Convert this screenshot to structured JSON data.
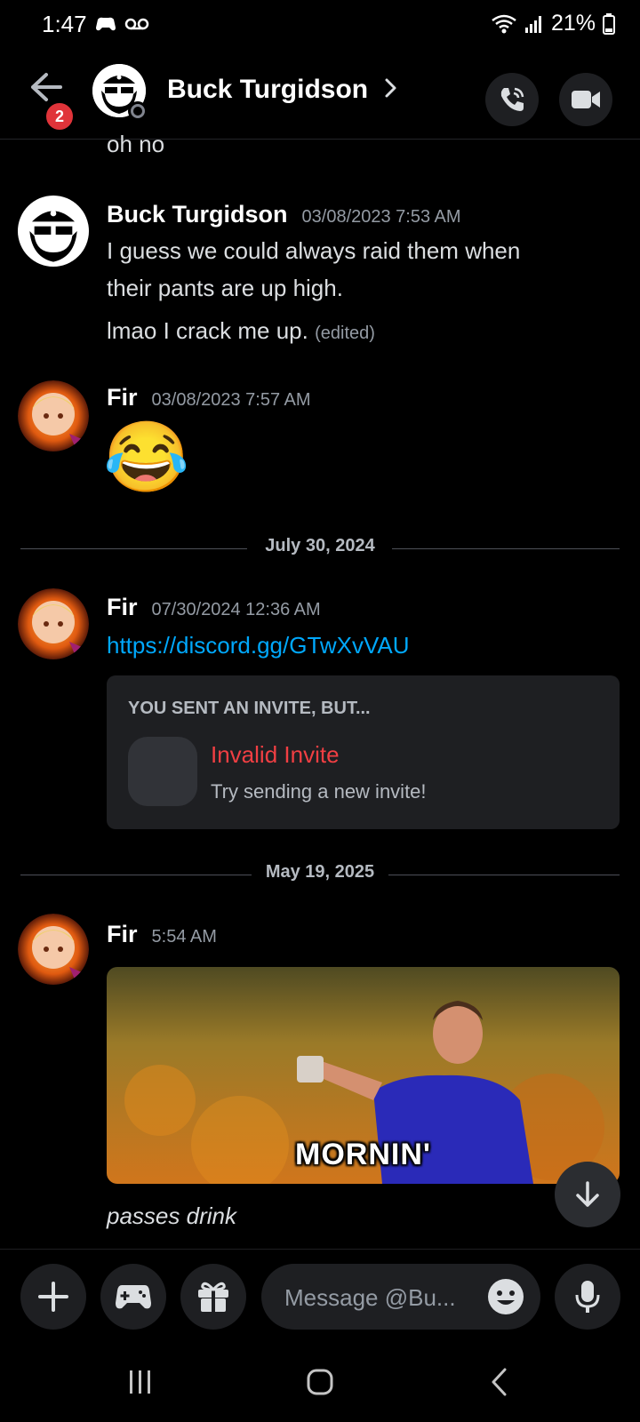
{
  "status_bar": {
    "time": "1:47",
    "battery": "21%"
  },
  "header": {
    "back_badge": "2",
    "contact_name": "Buck Turgidson"
  },
  "messages": {
    "top_fragment": "oh no",
    "m1": {
      "author": "Buck Turgidson",
      "timestamp": "03/08/2023 7:53 AM",
      "line1": "I guess we could always raid them when",
      "line2": "their pants are up high.",
      "line3": "lmao I crack me up.",
      "edited": "(edited)"
    },
    "m2": {
      "author": "Fir",
      "timestamp": "03/08/2023 7:57 AM",
      "emoji": "😂"
    },
    "divider1": "July 30, 2024",
    "m3": {
      "author": "Fir",
      "timestamp": "07/30/2024 12:36 AM",
      "link": "https://discord.gg/GTwXvVAU",
      "invite": {
        "heading": "YOU SENT AN INVITE, BUT...",
        "title": "Invalid Invite",
        "subtitle": "Try sending a new invite!"
      }
    },
    "divider2": "May 19, 2025",
    "m4": {
      "author": "Fir",
      "timestamp": "5:54 AM",
      "gif_caption": "MORNIN'",
      "text": "passes drink"
    }
  },
  "composer": {
    "placeholder": "Message @Bu..."
  },
  "icons": {
    "back": "arrow-left-icon",
    "call": "phone-icon",
    "video": "video-camera-icon",
    "add": "plus-icon",
    "activities": "gamepad-icon",
    "gift": "gift-icon",
    "emoji": "emoji-icon",
    "mic": "microphone-icon",
    "scroll": "arrow-down-icon"
  },
  "colors": {
    "background": "#000000",
    "link": "#00a8fc",
    "invalid": "#f23f43",
    "badge": "#e0343a"
  }
}
